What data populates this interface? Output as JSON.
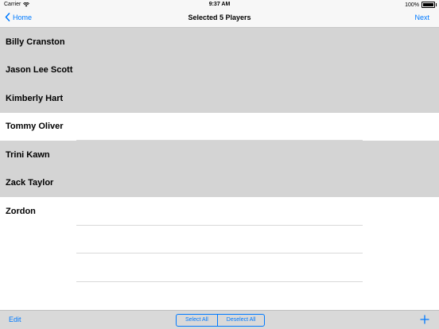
{
  "status_bar": {
    "carrier": "Carrier",
    "time": "9:37 AM",
    "battery": "100%"
  },
  "nav": {
    "back_label": "Home",
    "title": "Selected 5 Players",
    "next_label": "Next"
  },
  "players": [
    {
      "name": "Billy Cranston",
      "selected": true
    },
    {
      "name": "Jason Lee Scott",
      "selected": true
    },
    {
      "name": "Kimberly Hart",
      "selected": true
    },
    {
      "name": "Tommy Oliver",
      "selected": false
    },
    {
      "name": "Trini Kawn",
      "selected": true
    },
    {
      "name": "Zack Taylor",
      "selected": true
    },
    {
      "name": "Zordon",
      "selected": false
    }
  ],
  "toolbar": {
    "edit_label": "Edit",
    "select_all_label": "Select All",
    "deselect_all_label": "Deselect All"
  },
  "colors": {
    "accent": "#007aff",
    "selected_row": "#d4d4d4"
  }
}
